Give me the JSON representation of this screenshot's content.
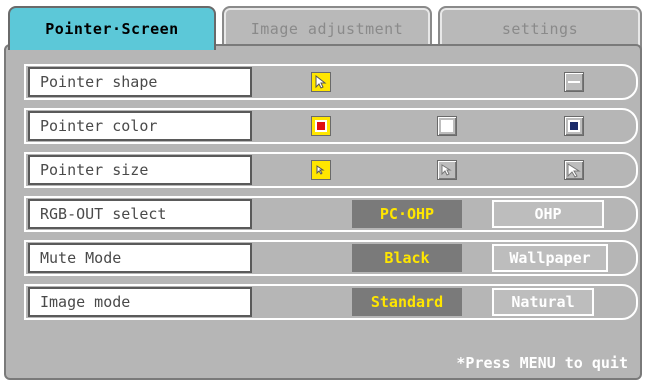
{
  "tabs": [
    {
      "label": "Pointer·Screen",
      "active": true
    },
    {
      "label": "Image adjustment",
      "active": false
    },
    {
      "label": "settings",
      "active": false
    }
  ],
  "rows": {
    "pointer_shape": {
      "label": "Pointer shape",
      "icons": [
        "arrow-pointer-icon",
        "line-pointer-icon"
      ],
      "selected": "arrow-pointer-icon"
    },
    "pointer_color": {
      "label": "Pointer color",
      "icons": [
        "red-color-swatch-icon",
        "white-color-swatch-icon",
        "navy-color-swatch-icon"
      ],
      "colors": [
        "#e01010",
        "#ffffff",
        "#1a2a6a"
      ],
      "selected": "red-color-swatch-icon"
    },
    "pointer_size": {
      "label": "Pointer size",
      "icons": [
        "small-pointer-icon",
        "medium-pointer-icon",
        "large-pointer-icon"
      ],
      "selected": "small-pointer-icon"
    },
    "rgb_out": {
      "label": "RGB-OUT select",
      "options": [
        "PC·OHP",
        "OHP"
      ],
      "selected": "PC·OHP"
    },
    "mute_mode": {
      "label": "Mute Mode",
      "options": [
        "Black",
        "Wallpaper"
      ],
      "selected": "Black"
    },
    "image_mode": {
      "label": "Image mode",
      "options": [
        "Standard",
        "Natural"
      ],
      "selected": "Standard"
    }
  },
  "footer": "*Press MENU to quit",
  "colors": {
    "accent_tab": "#5cc8d8",
    "panel": "#b6b6b6",
    "selected_text": "#ffe600"
  }
}
